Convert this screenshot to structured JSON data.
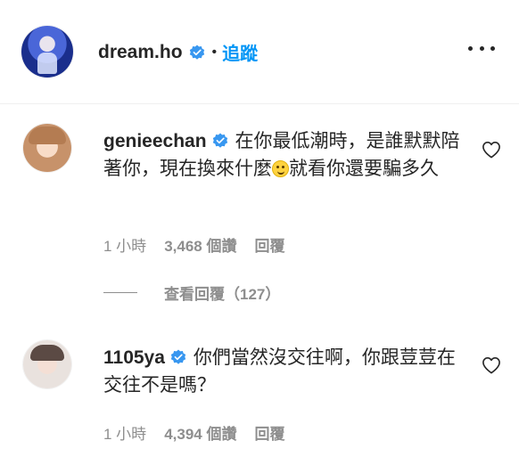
{
  "header": {
    "username": "dream.ho",
    "separator": "•",
    "follow_label": "追蹤",
    "avatar_icon": "profile-avatar",
    "more_icon": "more-options-icon"
  },
  "comments": [
    {
      "username": "genieechan",
      "text_before_emoji": "在你最低潮時，是誰默默陪著你，現在換來什麼",
      "emoji": "slightly-smiling-face",
      "text_after_emoji": "就看你還要騙多久",
      "time": "1 小時",
      "likes": "3,468 個讚",
      "reply_label": "回覆",
      "view_replies": "查看回覆（127）"
    },
    {
      "username": "1105ya",
      "text": "你們當然沒交往啊，你跟荳荳在交往不是嗎？",
      "time": "1 小時",
      "likes": "4,394 個讚",
      "reply_label": "回覆"
    }
  ],
  "colors": {
    "link_blue": "#0095f6",
    "verified_blue": "#3897f0",
    "muted_gray": "#8e8e8e",
    "text_dark": "#262626"
  }
}
